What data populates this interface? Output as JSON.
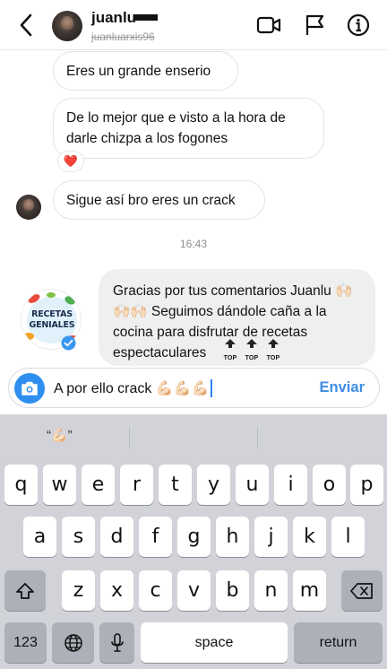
{
  "header": {
    "name": "juanlu",
    "username": "juanluarxis96",
    "icons": [
      "chevron-left-icon",
      "video-camera-icon",
      "flag-icon",
      "info-icon"
    ]
  },
  "messages": {
    "m1": "Eres un grande enserio",
    "m2": "De lo mejor que e visto a la hora de darle chizpa a los fogones",
    "m2_reaction": "❤️",
    "m3": "Sigue así bro eres un crack",
    "timestamp": "16:43",
    "reply": "Gracias por tus comentarios Juanlu 🙌🏻🙌🏻🙌🏻 Seguimos dándole caña a la cocina para disfrutar de recetas espectaculares",
    "reply_tops": [
      "TOP",
      "TOP",
      "TOP"
    ],
    "logo_line1": "RECETAS",
    "logo_line2": "GENIALES"
  },
  "composer": {
    "text": "A por ello crack 💪🏻💪🏻💪🏻",
    "send_label": "Enviar"
  },
  "keyboard": {
    "suggestion": "“💪🏻”",
    "row1": [
      "q",
      "w",
      "e",
      "r",
      "t",
      "y",
      "u",
      "i",
      "o",
      "p"
    ],
    "row2": [
      "a",
      "s",
      "d",
      "f",
      "g",
      "h",
      "j",
      "k",
      "l"
    ],
    "row3": [
      "z",
      "x",
      "c",
      "v",
      "b",
      "n",
      "m"
    ],
    "numbers_label": "123",
    "space_label": "space",
    "return_label": "return"
  },
  "colors": {
    "accent": "#3f8de4",
    "camera": "#2f8ff0",
    "incoming_border": "#e3e3e3",
    "outgoing_bg": "#efefef",
    "keyboard_bg": "#d1d3d9"
  }
}
